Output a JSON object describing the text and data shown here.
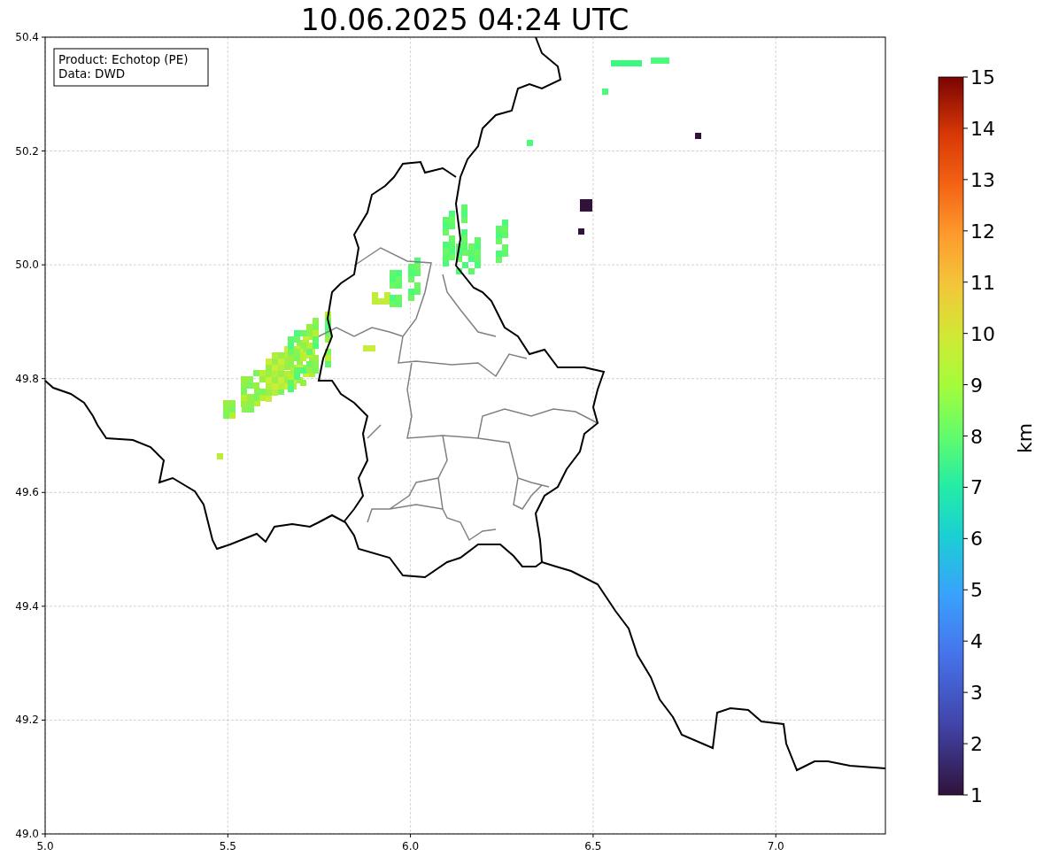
{
  "title": "10.06.2025 04:24 UTC",
  "info_box": [
    "Product: Echotop (PE)",
    "Data: DWD"
  ],
  "x_ticks": [
    "5.0",
    "5.5",
    "6.0",
    "6.5",
    "7.0"
  ],
  "y_ticks": [
    "50.4",
    "50.2",
    "50.0",
    "49.8",
    "49.6",
    "49.4",
    "49.2",
    "49.0"
  ],
  "colorbar": {
    "label": "km",
    "ticks": [
      "15",
      "14",
      "13",
      "12",
      "11",
      "10",
      "9",
      "8",
      "7",
      "6",
      "5",
      "4",
      "3",
      "2",
      "1"
    ]
  }
}
